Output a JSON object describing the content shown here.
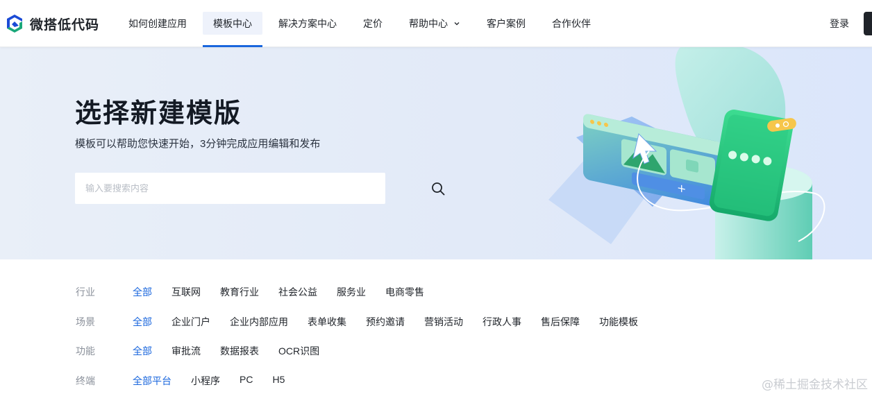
{
  "header": {
    "brand": "微搭低代码",
    "nav": [
      {
        "label": "如何创建应用",
        "active": false
      },
      {
        "label": "模板中心",
        "active": true
      },
      {
        "label": "解决方案中心",
        "active": false
      },
      {
        "label": "定价",
        "active": false
      },
      {
        "label": "帮助中心",
        "active": false,
        "has_dropdown": true
      },
      {
        "label": "客户案例",
        "active": false
      },
      {
        "label": "合作伙伴",
        "active": false
      }
    ],
    "login_label": "登录"
  },
  "hero": {
    "title": "选择新建模版",
    "subtitle": "模板可以帮助您快速开始，3分钟完成应用编辑和发布",
    "search": {
      "value": "",
      "placeholder": "输入要搜索内容",
      "icon": "search-icon"
    }
  },
  "filters": {
    "industry": {
      "label": "行业",
      "options": [
        "全部",
        "互联网",
        "教育行业",
        "社会公益",
        "服务业",
        "电商零售"
      ],
      "selected": "全部"
    },
    "scene": {
      "label": "场景",
      "options": [
        "全部",
        "企业门户",
        "企业内部应用",
        "表单收集",
        "预约邀请",
        "营销活动",
        "行政人事",
        "售后保障",
        "功能模板"
      ],
      "selected": "全部"
    },
    "function": {
      "label": "功能",
      "options": [
        "全部",
        "审批流",
        "数据报表",
        "OCR识图"
      ],
      "selected": "全部"
    },
    "terminal": {
      "label": "终端",
      "options": [
        "全部平台",
        "小程序",
        "PC",
        "H5"
      ],
      "selected": "全部平台"
    }
  },
  "watermark": "@稀土掘金技术社区",
  "colors": {
    "accent": "#1966dd",
    "hero_bg": "#e2eaf8",
    "text": "#1f2329",
    "muted": "#8b919b"
  }
}
